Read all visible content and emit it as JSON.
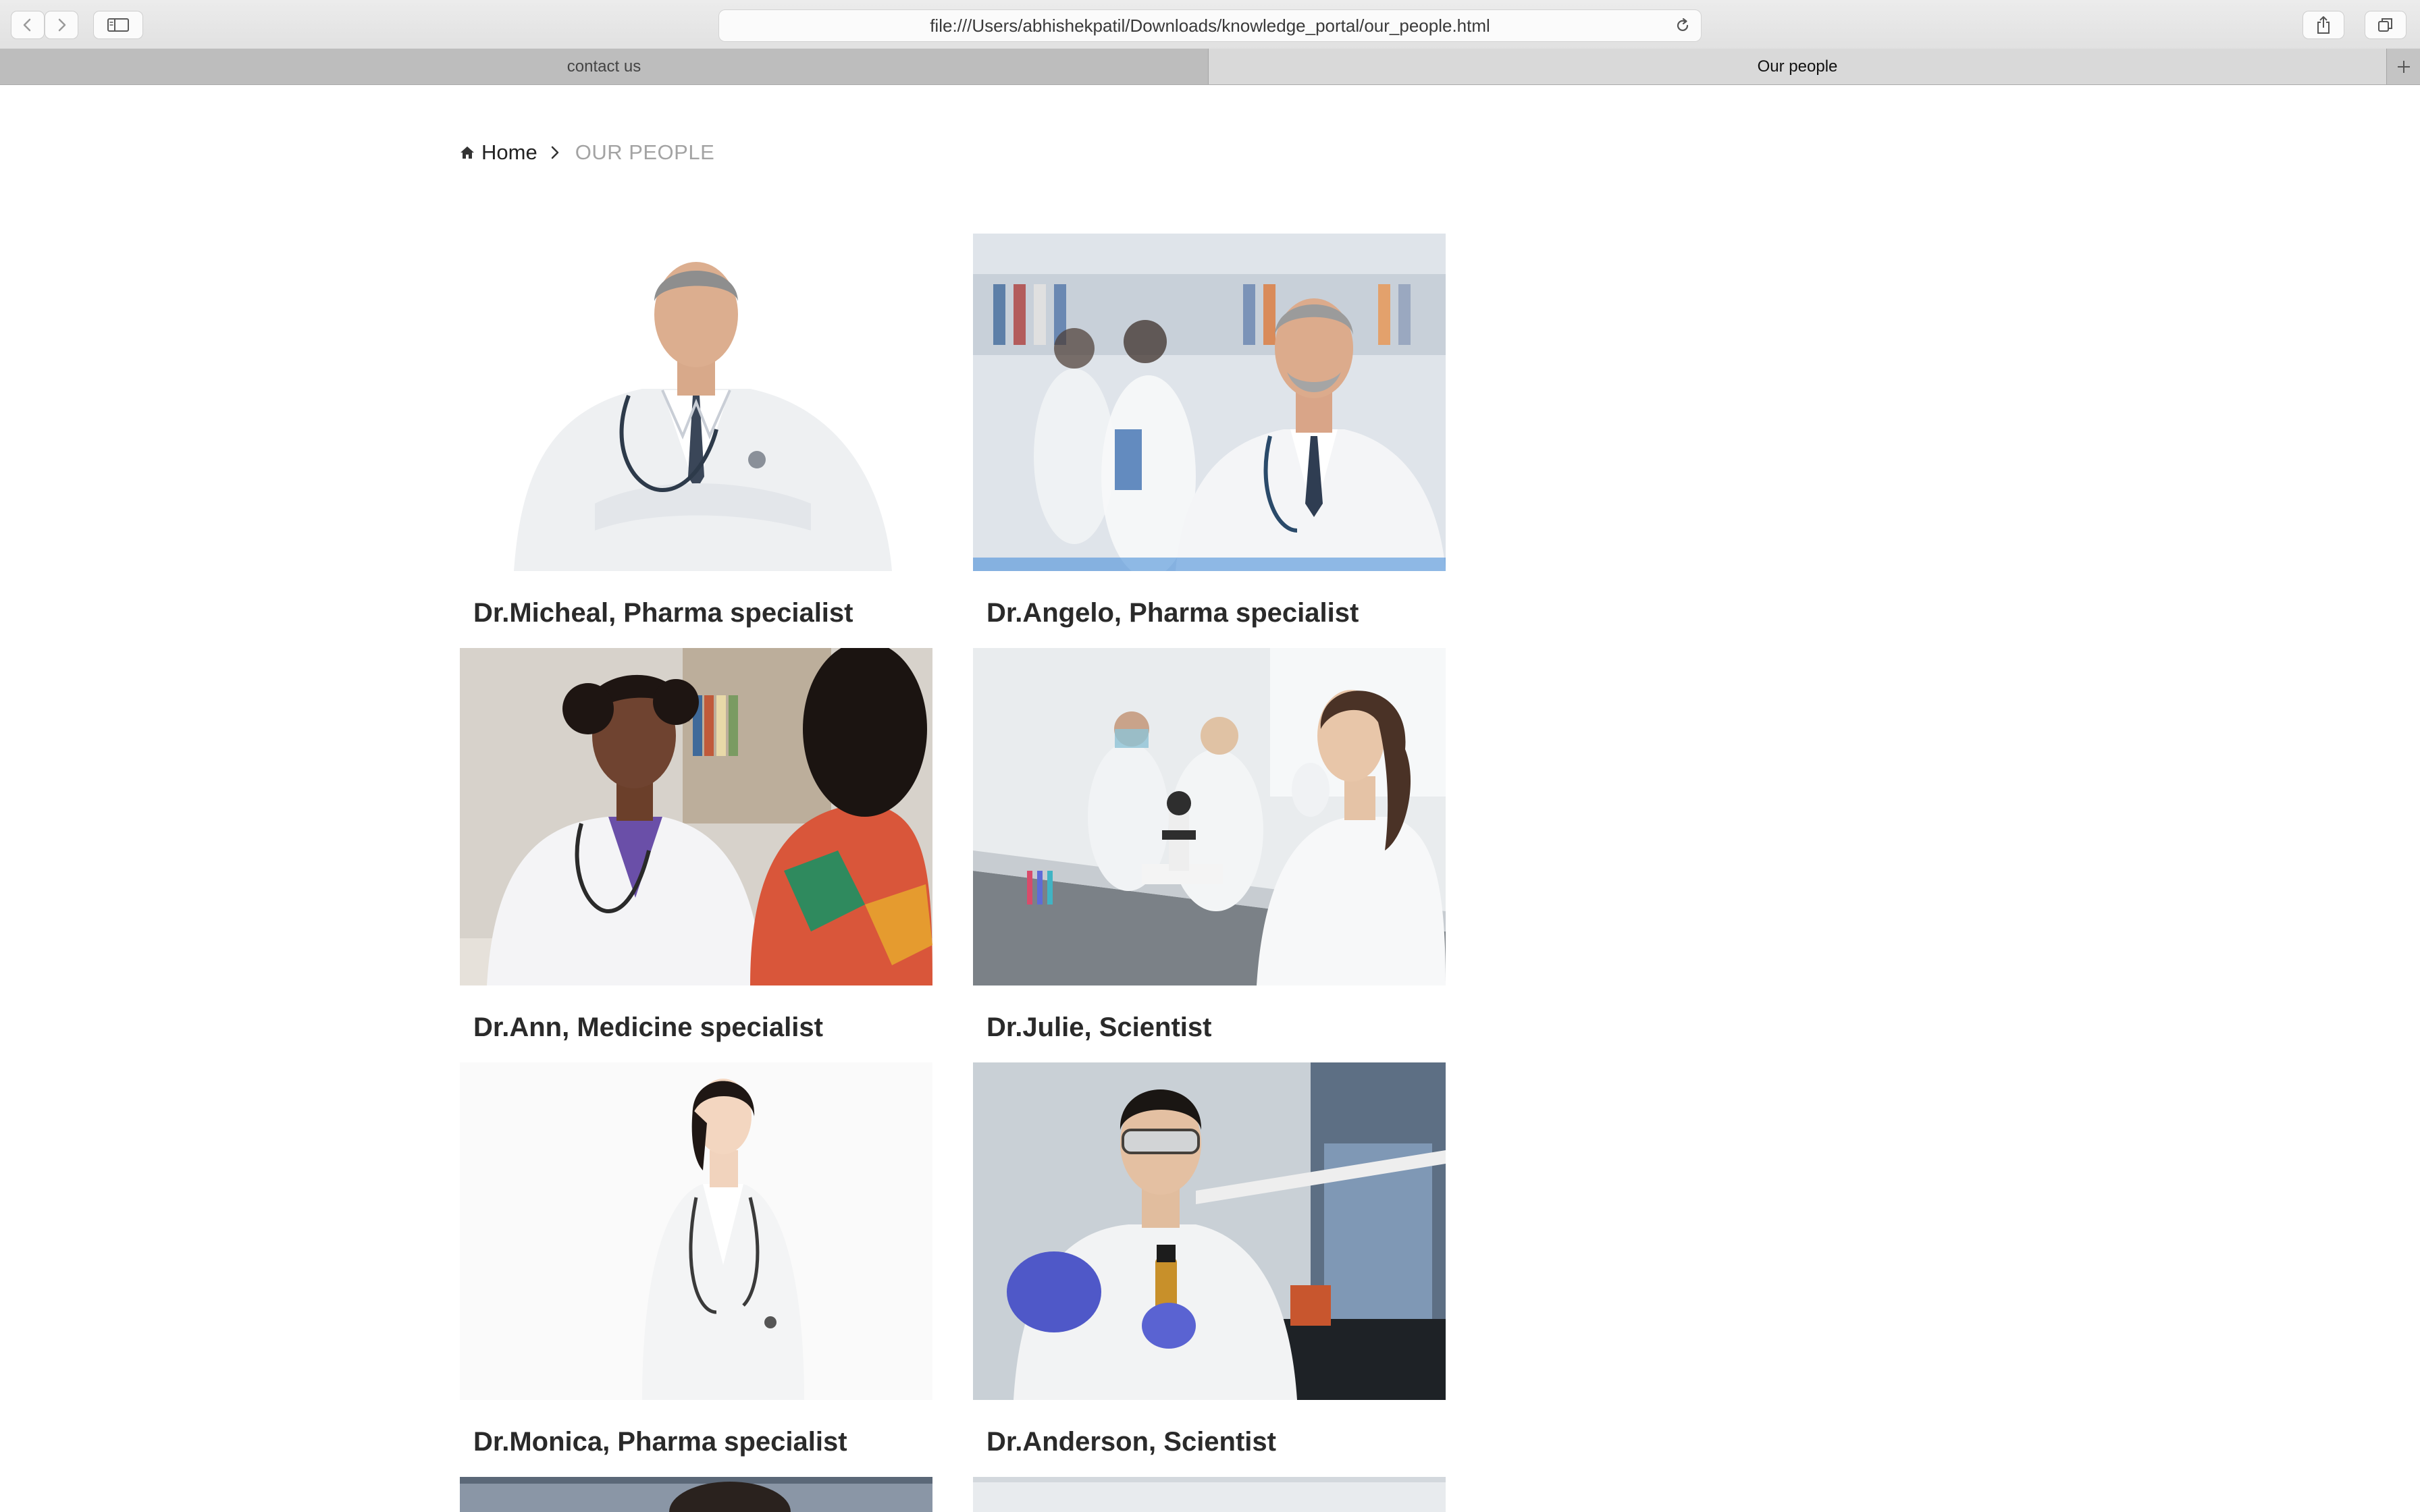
{
  "browser": {
    "url": "file:///Users/abhishekpatil/Downloads/knowledge_portal/our_people.html",
    "tabs": [
      {
        "label": "contact us",
        "active": false
      },
      {
        "label": "Our people",
        "active": true
      }
    ],
    "icons": [
      "back-icon",
      "forward-icon",
      "sidebar-icon",
      "reload-icon",
      "share-icon",
      "tabs-overview-icon",
      "plus-icon"
    ]
  },
  "breadcrumb": {
    "home_label": "Home",
    "current_label": "OUR PEOPLE"
  },
  "people": [
    {
      "name": "Dr.Micheal, Pharma specialist"
    },
    {
      "name": "Dr.Angelo, Pharma specialist"
    },
    {
      "name": "Dr.Ann, Medicine specialist"
    },
    {
      "name": "Dr.Julie, Scientist"
    },
    {
      "name": "Dr.Monica, Pharma specialist"
    },
    {
      "name": "Dr.Anderson, Scientist"
    }
  ],
  "colors": {
    "page_background": "#ffffff",
    "name_text": "#2a2a2a",
    "breadcrumb_current": "#a3a3a3"
  }
}
